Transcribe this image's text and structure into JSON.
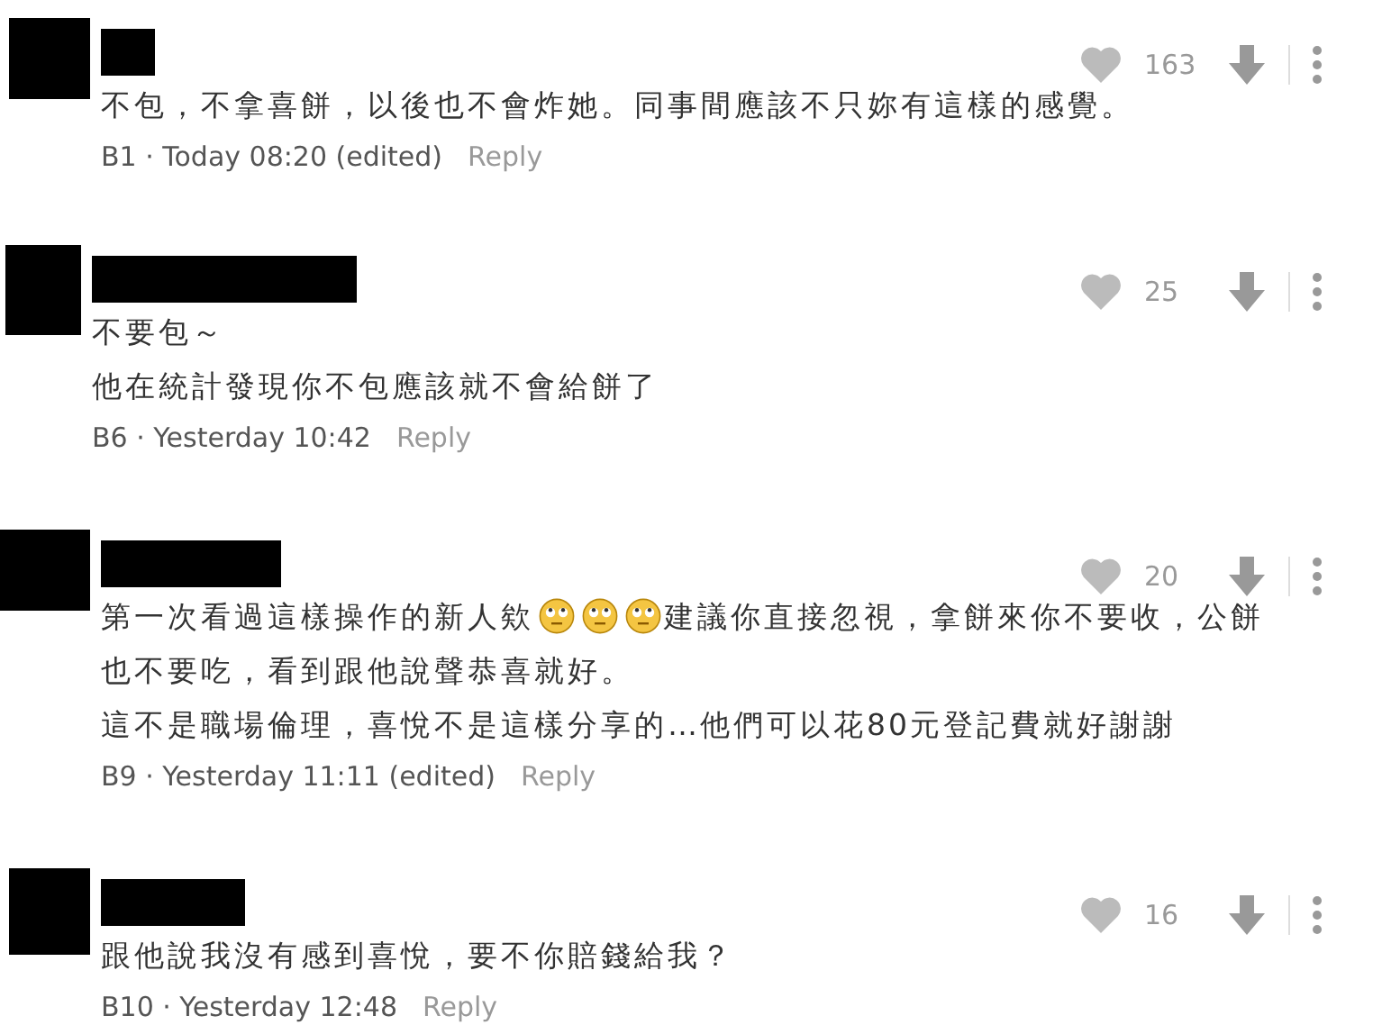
{
  "comments": [
    {
      "author_redacted": true,
      "likes": "163",
      "body": [
        [
          {
            "kind": "text",
            "text": "不包，不拿喜餅，以後也不會炸她。同事間應該不只妳有這樣的感覺。"
          }
        ]
      ],
      "meta": "B1 · Today 08:20 (edited)",
      "reply": "Reply"
    },
    {
      "author_redacted": true,
      "likes": "25",
      "body": [
        [
          {
            "kind": "text",
            "text": "不要包～"
          }
        ],
        [
          {
            "kind": "text",
            "text": "他在統計發現你不包應該就不會給餅了"
          }
        ]
      ],
      "meta": "B6 · Yesterday 10:42",
      "reply": "Reply"
    },
    {
      "author_redacted": true,
      "likes": "20",
      "body": [
        [
          {
            "kind": "text",
            "text": "第一次看過這樣操作的新人欸"
          },
          {
            "kind": "emoji"
          },
          {
            "kind": "emoji"
          },
          {
            "kind": "emoji"
          },
          {
            "kind": "text",
            "text": "建議你直接忽視，拿餅來你不要收，公餅"
          }
        ],
        [
          {
            "kind": "text",
            "text": "也不要吃，看到跟他說聲恭喜就好。"
          }
        ],
        [
          {
            "kind": "text",
            "text": "這不是職場倫理，喜悅不是這樣分享的…他們可以花80元登記費就好謝謝"
          }
        ]
      ],
      "meta": "B9 · Yesterday 11:11 (edited)",
      "reply": "Reply"
    },
    {
      "author_redacted": true,
      "likes": "16",
      "body": [
        [
          {
            "kind": "text",
            "text": "跟他說我沒有感到喜悅，要不你賠錢給我？"
          }
        ]
      ],
      "meta": "B10 · Yesterday 12:48",
      "reply": "Reply"
    }
  ]
}
